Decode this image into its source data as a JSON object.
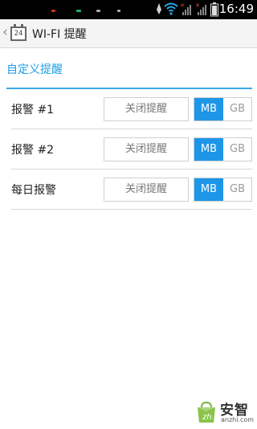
{
  "status_bar": {
    "time": "16:49"
  },
  "action_bar": {
    "app_icon_text": "24",
    "title": "WI-FI 提醒"
  },
  "section": {
    "title": "自定义提醒"
  },
  "rows": [
    {
      "label": "报警 #1",
      "off_label": "关闭提醒",
      "unit_mb": "MB",
      "unit_gb": "GB",
      "selected_unit": "MB"
    },
    {
      "label": "报警 #2",
      "off_label": "关闭提醒",
      "unit_mb": "MB",
      "unit_gb": "GB",
      "selected_unit": "MB"
    },
    {
      "label": "每日报警",
      "off_label": "关闭提醒",
      "unit_mb": "MB",
      "unit_gb": "GB",
      "selected_unit": "MB"
    }
  ],
  "watermark": {
    "brand": "安智",
    "url": "anzhi.com"
  },
  "colors": {
    "accent": "#1e96e8",
    "section_title": "#1e9ee6",
    "status_bar": "#000000"
  }
}
